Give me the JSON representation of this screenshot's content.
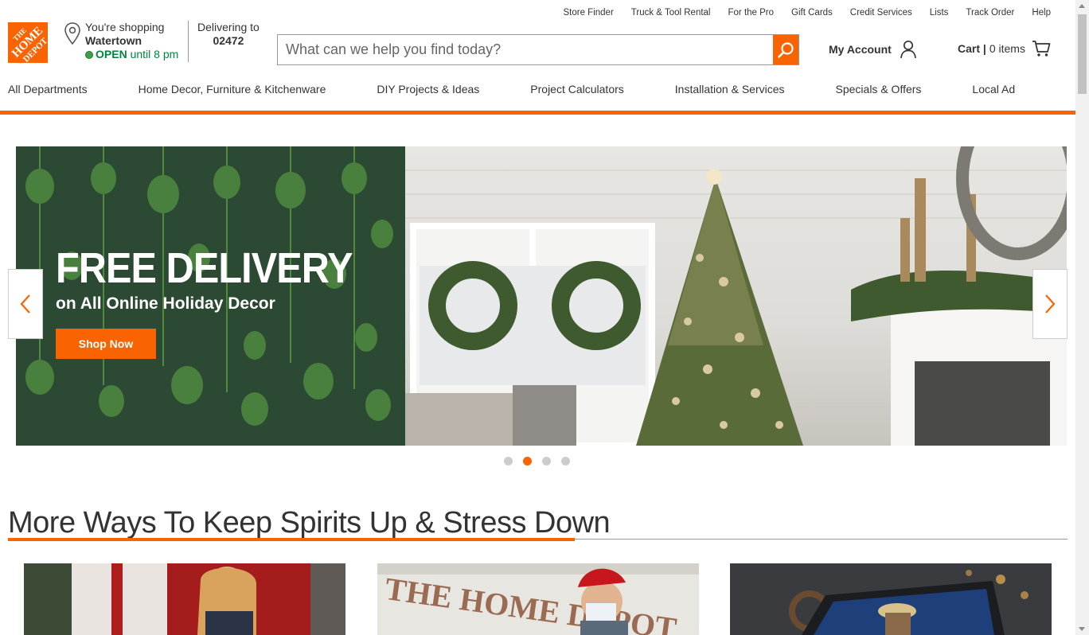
{
  "utility_links": [
    "Store Finder",
    "Truck & Tool Rental",
    "For the Pro",
    "Gift Cards",
    "Credit Services",
    "Lists",
    "Track Order",
    "Help"
  ],
  "logo_text": "THE HOME DEPOT",
  "store": {
    "label": "You're shopping",
    "city": "Watertown",
    "open": "OPEN",
    "hours": "until 8 pm"
  },
  "delivery": {
    "label": "Delivering to",
    "zip": "02472"
  },
  "search": {
    "placeholder": "What can we help you find today?"
  },
  "account": {
    "label": "My Account"
  },
  "cart": {
    "label": "Cart |",
    "count": "0 items"
  },
  "nav": {
    "items": [
      "All Departments",
      "Home Decor, Furniture & Kitchenware",
      "DIY Projects & Ideas",
      "Project Calculators",
      "Installation & Services",
      "Specials & Offers",
      "Local Ad"
    ]
  },
  "hero": {
    "title": "FREE DELIVERY",
    "subtitle": "on All Online Holiday Decor",
    "button": "Shop Now",
    "slides_total": 4,
    "active_slide": 2
  },
  "section": {
    "title": "More Ways To Keep Spirits Up & Stress Down"
  },
  "colors": {
    "brand_orange": "#f96302",
    "open_green": "#00853e",
    "hero_green": "#2c4a33"
  }
}
